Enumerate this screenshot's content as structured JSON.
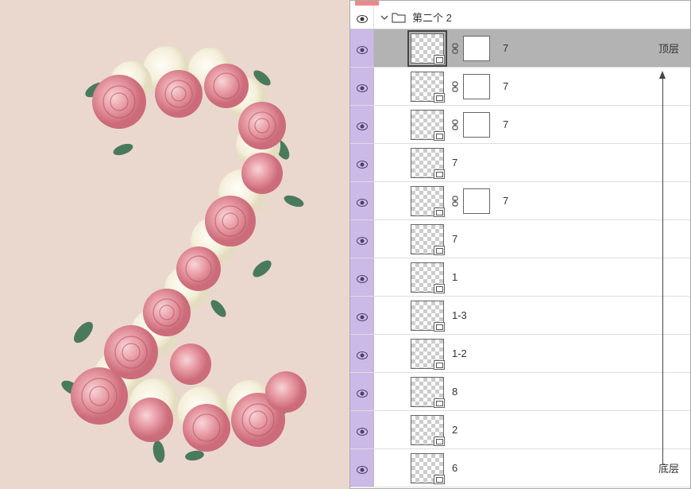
{
  "canvas": {
    "background": "#ead8cf"
  },
  "panel": {
    "group_name": "第二个 2",
    "top_label": "顶层",
    "bottom_label": "底层"
  },
  "layers": [
    {
      "name": "7",
      "has_mask": true,
      "selected": true,
      "label": "top"
    },
    {
      "name": "7",
      "has_mask": true,
      "selected": false
    },
    {
      "name": "7",
      "has_mask": true,
      "selected": false
    },
    {
      "name": "7",
      "has_mask": false,
      "selected": false
    },
    {
      "name": "7",
      "has_mask": true,
      "selected": false
    },
    {
      "name": "7",
      "has_mask": false,
      "selected": false
    },
    {
      "name": "1",
      "has_mask": false,
      "selected": false
    },
    {
      "name": "1-3",
      "has_mask": false,
      "selected": false
    },
    {
      "name": "1-2",
      "has_mask": false,
      "selected": false
    },
    {
      "name": "8",
      "has_mask": false,
      "selected": false
    },
    {
      "name": "2",
      "has_mask": false,
      "selected": false
    },
    {
      "name": "6",
      "has_mask": false,
      "selected": false,
      "label": "bottom"
    }
  ]
}
